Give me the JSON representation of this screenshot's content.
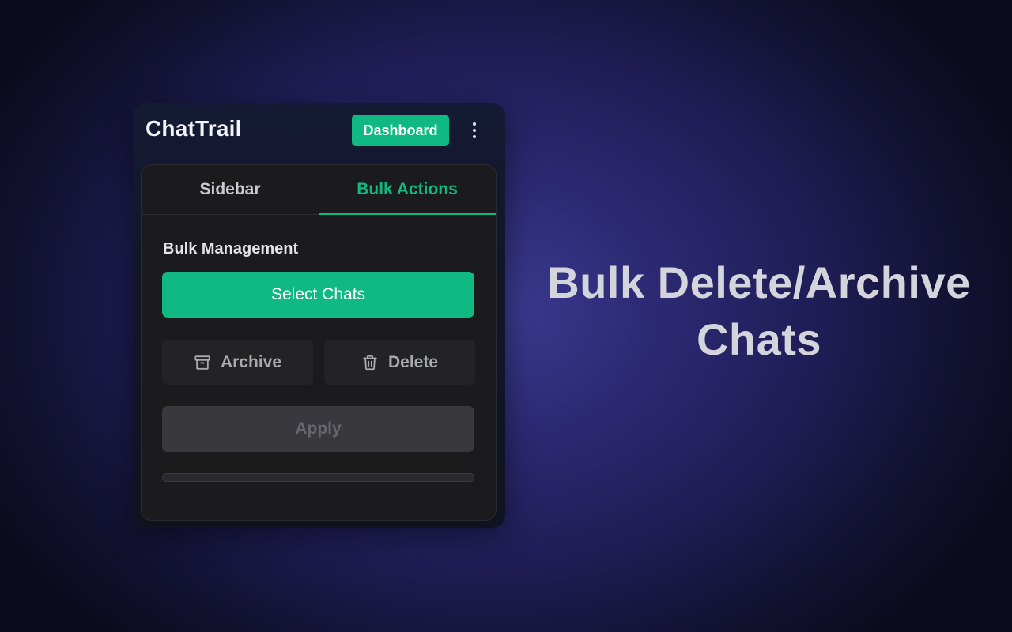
{
  "header": {
    "brand": "ChatTrail",
    "dashboard_label": "Dashboard",
    "menu_icon": "more-vertical-icon"
  },
  "tabs": [
    {
      "label": "Sidebar",
      "active": false
    },
    {
      "label": "Bulk Actions",
      "active": true
    }
  ],
  "bulk": {
    "section_title": "Bulk Management",
    "select_label": "Select Chats",
    "archive_label": "Archive",
    "archive_icon": "archive-icon",
    "delete_label": "Delete",
    "delete_icon": "trash-icon",
    "apply_label": "Apply",
    "progress": 0
  },
  "headline": {
    "line1": "Bulk Delete/Archive",
    "line2": "Chats"
  },
  "colors": {
    "accent": "#10b981",
    "panel_bg": "#1b1b1d",
    "disabled_bg": "#38383d"
  }
}
